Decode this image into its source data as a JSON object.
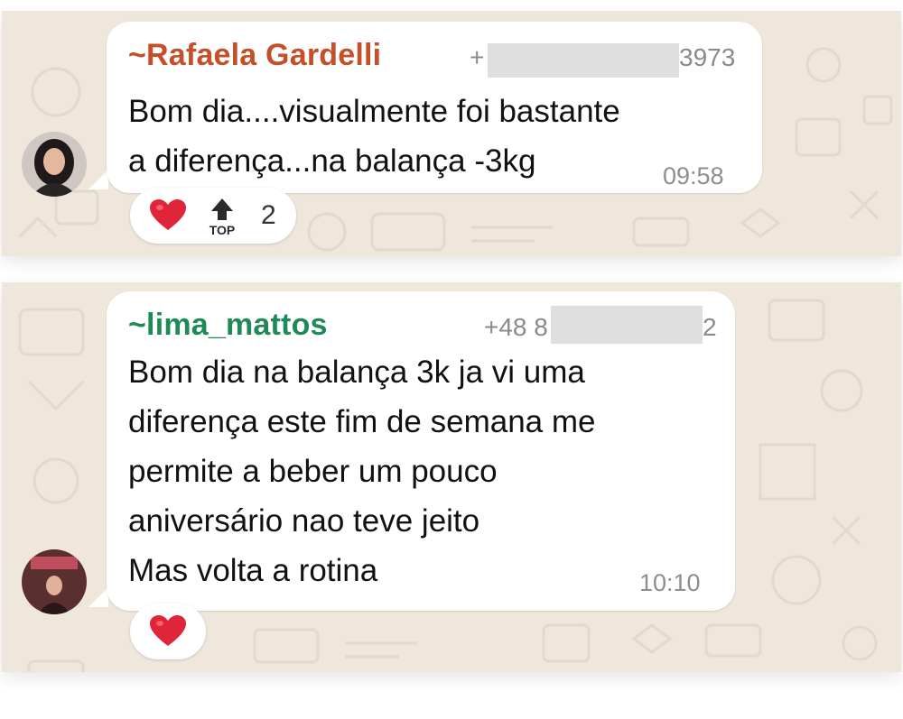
{
  "messages": [
    {
      "sender": "~Rafaela Gardelli",
      "phone_prefix": "+",
      "phone_suffix": "3973",
      "text": "Bom dia....visualmente foi bastante\na diferença...na balança -3kg",
      "time": "09:58",
      "reaction": {
        "emoji": "heart",
        "extra_icon": "top-arrow",
        "top_label": "TOP",
        "count": "2"
      }
    },
    {
      "sender": "~lima_mattos",
      "phone_prefix": "+48 8",
      "phone_suffix": "2",
      "text": "Bom dia na balança 3k ja vi uma\ndiferença este fim de semana me\npermite a beber um pouco\naniversário nao teve jeito\nMas volta a rotina",
      "time": "10:10",
      "reaction": {
        "emoji": "heart"
      }
    }
  ],
  "colors": {
    "sender1": "#c4502a",
    "sender2": "#1f8a55",
    "background": "#efe7dc",
    "bubble": "#ffffff",
    "heart": "#e0243a"
  }
}
